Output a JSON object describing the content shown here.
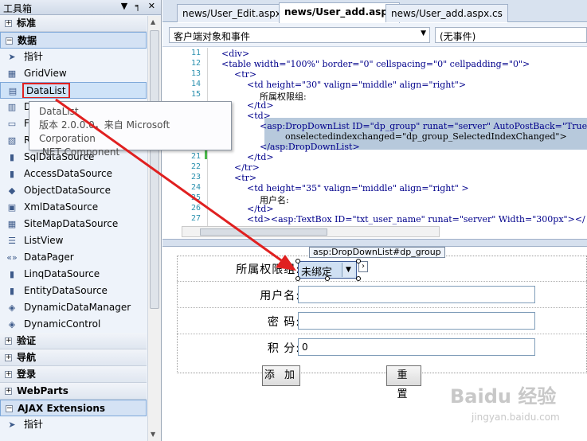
{
  "toolbox": {
    "title": "工具箱",
    "pin_icons": "▼ ╕ ✕",
    "categories_top": [
      {
        "label": "标准",
        "state": "+"
      },
      {
        "label": "数据",
        "state": "−"
      }
    ],
    "data_items": [
      {
        "label": "指针",
        "icon": "pointer-icon",
        "glyph": "➤"
      },
      {
        "label": "GridView",
        "icon": "gridview-icon",
        "glyph": "▦"
      },
      {
        "label": "DataList",
        "icon": "datalist-icon",
        "glyph": "▤"
      },
      {
        "label": "D",
        "icon": "detailsview-icon",
        "glyph": "▥"
      },
      {
        "label": "Fo",
        "icon": "formview-icon",
        "glyph": "▭"
      },
      {
        "label": "Re",
        "icon": "repeater-icon",
        "glyph": "▧"
      },
      {
        "label": "SqlDataSource",
        "icon": "sqldatasource-icon",
        "glyph": "▮"
      },
      {
        "label": "AccessDataSource",
        "icon": "accessdatasource-icon",
        "glyph": "▮"
      },
      {
        "label": "ObjectDataSource",
        "icon": "objectdatasource-icon",
        "glyph": "◆"
      },
      {
        "label": "XmlDataSource",
        "icon": "xmldatasource-icon",
        "glyph": "▣"
      },
      {
        "label": "SiteMapDataSource",
        "icon": "sitemapdatasource-icon",
        "glyph": "▦"
      },
      {
        "label": "ListView",
        "icon": "listview-icon",
        "glyph": "☰"
      },
      {
        "label": "DataPager",
        "icon": "datapager-icon",
        "glyph": "«»"
      },
      {
        "label": "LinqDataSource",
        "icon": "linqdatasource-icon",
        "glyph": "▮"
      },
      {
        "label": "EntityDataSource",
        "icon": "entitydatasource-icon",
        "glyph": "▮"
      },
      {
        "label": "DynamicDataManager",
        "icon": "dynamicdatamanager-icon",
        "glyph": "◈"
      },
      {
        "label": "DynamicControl",
        "icon": "dynamiccontrol-icon",
        "glyph": "◈"
      }
    ],
    "categories_bottom": [
      {
        "label": "验证",
        "state": "+"
      },
      {
        "label": "导航",
        "state": "+"
      },
      {
        "label": "登录",
        "state": "+"
      },
      {
        "label": "WebParts",
        "state": "+"
      },
      {
        "label": "AJAX Extensions",
        "state": "−"
      }
    ],
    "ajax_items": [
      {
        "label": "指针",
        "icon": "pointer-icon",
        "glyph": "➤"
      }
    ],
    "tooltip": {
      "line1": "DataList",
      "line2": "版本 2.0.0.0，来自 Microsoft Corporation",
      "line3": ".NET Component"
    }
  },
  "editor": {
    "tabs": [
      "news/User_Edit.aspx",
      "news/User_add.aspx",
      "news/User_add.aspx.cs"
    ],
    "active_tab": 1,
    "client_objects_dropdown": "客户端对象和事件",
    "events_dropdown": "(无事件)",
    "code_lines": [
      {
        "n": "11",
        "t": "<div>"
      },
      {
        "n": "12",
        "t": "<table width=\"100%\" border=\"0\" cellspacing=\"0\" cellpadding=\"0\">"
      },
      {
        "n": "13",
        "t": "<tr>"
      },
      {
        "n": "14",
        "t": "<td height=\"30\" valign=\"middle\" align=\"right\">"
      },
      {
        "n": "15",
        "t": "所属权限组:"
      },
      {
        "n": "16",
        "t": "</td>"
      },
      {
        "n": "17",
        "t": "<td>"
      },
      {
        "n": "18",
        "t": "<asp:DropDownList ID=\"dp_group\" runat=\"server\" AutoPostBack=\"True\""
      },
      {
        "n": "19",
        "t": "onselectedindexchanged=\"dp_group_SelectedIndexChanged\">"
      },
      {
        "n": "20",
        "t": "</asp:DropDownList>"
      },
      {
        "n": "21",
        "t": "</td>"
      },
      {
        "n": "22",
        "t": "</tr>"
      },
      {
        "n": "23",
        "t": "<tr>"
      },
      {
        "n": "24",
        "t": "<td height=\"35\" valign=\"middle\" align=\"right\" >"
      },
      {
        "n": "25",
        "t": "用户名:"
      },
      {
        "n": "26",
        "t": "</td>"
      },
      {
        "n": "27",
        "t": "<td><asp:TextBox ID=\"txt_user_name\" runat=\"server\" Width=\"300px\"></"
      }
    ]
  },
  "design": {
    "ddl_caption": "asp:DropDownList#dp_group",
    "rows": [
      {
        "label": "所属权限组:",
        "type": "dropdown",
        "value": "未绑定"
      },
      {
        "label": "用户名:",
        "type": "text",
        "value": ""
      },
      {
        "label": "密 码:",
        "type": "text",
        "value": ""
      },
      {
        "label": "积 分:",
        "type": "text",
        "value": "0"
      }
    ],
    "buttons": [
      "添 加",
      "重 置"
    ]
  },
  "watermark": {
    "main": "Baidu 经验",
    "sub": "jingyan.baidu.com"
  },
  "colors": {
    "highlight_red": "#e02020",
    "selection_blue": "#cfe3f8",
    "code_highlight": "#b7c9dc"
  }
}
